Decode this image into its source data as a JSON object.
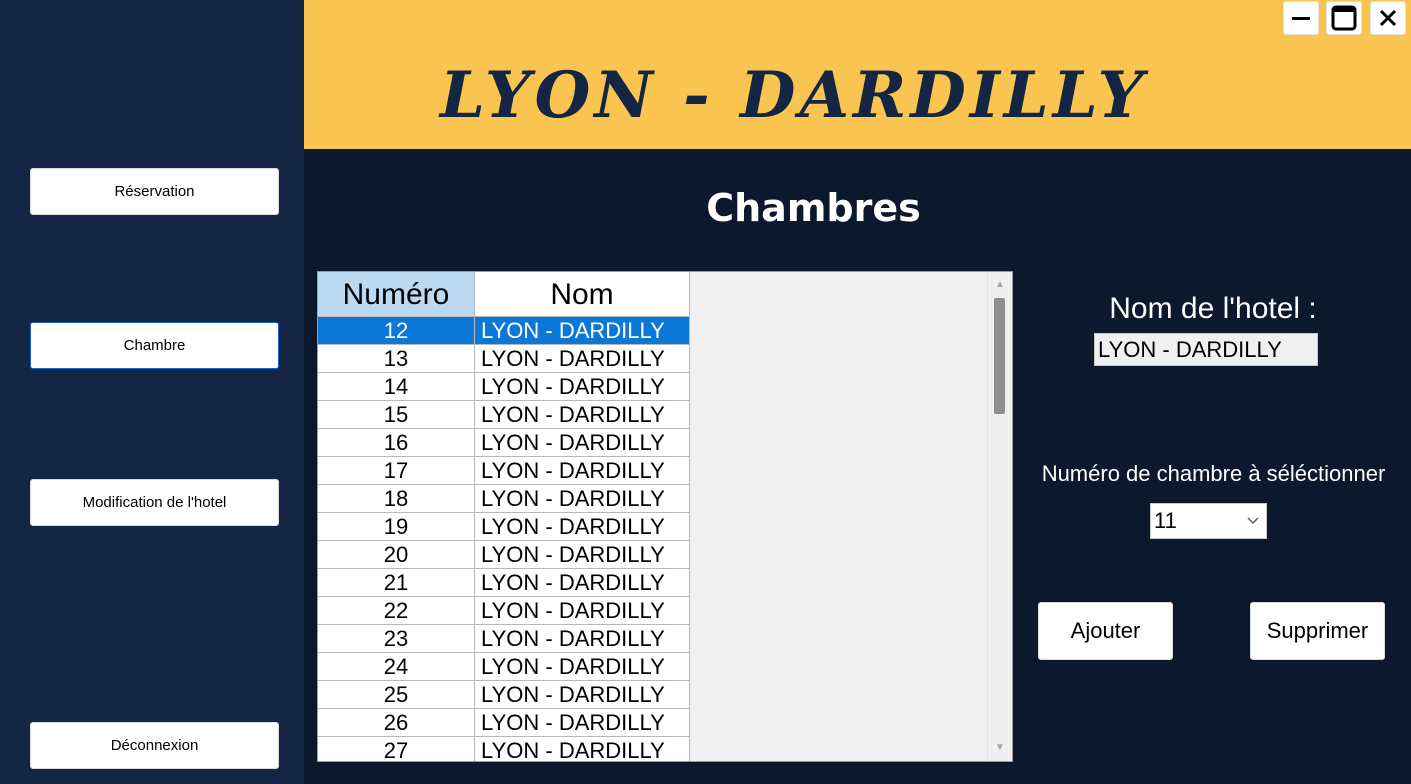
{
  "app": {
    "brand_title": "LYON - DARDILLY",
    "colors": {
      "sidebar": "#142644",
      "header": "#f9c44f",
      "main_background": "#0c182b",
      "brand_text": "#142644",
      "selected_row": "#0b78d8",
      "header_cell": "#bcd9f2"
    }
  },
  "window_controls": {
    "minimize_icon": "minimize-icon",
    "maximize_icon": "maximize-icon",
    "close_icon": "close-icon"
  },
  "sidebar": {
    "items": [
      {
        "label": "Réservation",
        "active": false
      },
      {
        "label": "Chambre",
        "active": true
      },
      {
        "label": "Modification de l'hotel",
        "active": false
      },
      {
        "label": "Déconnexion",
        "active": false
      }
    ]
  },
  "main": {
    "title": "Chambres",
    "grid": {
      "columns": [
        "Numéro",
        "Nom"
      ],
      "selected_numero": "12",
      "rows": [
        {
          "numero": "12",
          "nom": "LYON - DARDILLY"
        },
        {
          "numero": "13",
          "nom": "LYON - DARDILLY"
        },
        {
          "numero": "14",
          "nom": "LYON - DARDILLY"
        },
        {
          "numero": "15",
          "nom": "LYON - DARDILLY"
        },
        {
          "numero": "16",
          "nom": "LYON - DARDILLY"
        },
        {
          "numero": "17",
          "nom": "LYON - DARDILLY"
        },
        {
          "numero": "18",
          "nom": "LYON - DARDILLY"
        },
        {
          "numero": "19",
          "nom": "LYON - DARDILLY"
        },
        {
          "numero": "20",
          "nom": "LYON - DARDILLY"
        },
        {
          "numero": "21",
          "nom": "LYON - DARDILLY"
        },
        {
          "numero": "22",
          "nom": "LYON - DARDILLY"
        },
        {
          "numero": "23",
          "nom": "LYON - DARDILLY"
        },
        {
          "numero": "24",
          "nom": "LYON - DARDILLY"
        },
        {
          "numero": "25",
          "nom": "LYON - DARDILLY"
        },
        {
          "numero": "26",
          "nom": "LYON - DARDILLY"
        },
        {
          "numero": "27",
          "nom": "LYON - DARDILLY"
        }
      ]
    }
  },
  "form": {
    "hotel_name_label": "Nom de l'hotel :",
    "hotel_name_value": "LYON - DARDILLY",
    "room_number_label": "Numéro de chambre à séléctionner",
    "room_number_selected": "11",
    "add_label": "Ajouter",
    "delete_label": "Supprimer"
  }
}
